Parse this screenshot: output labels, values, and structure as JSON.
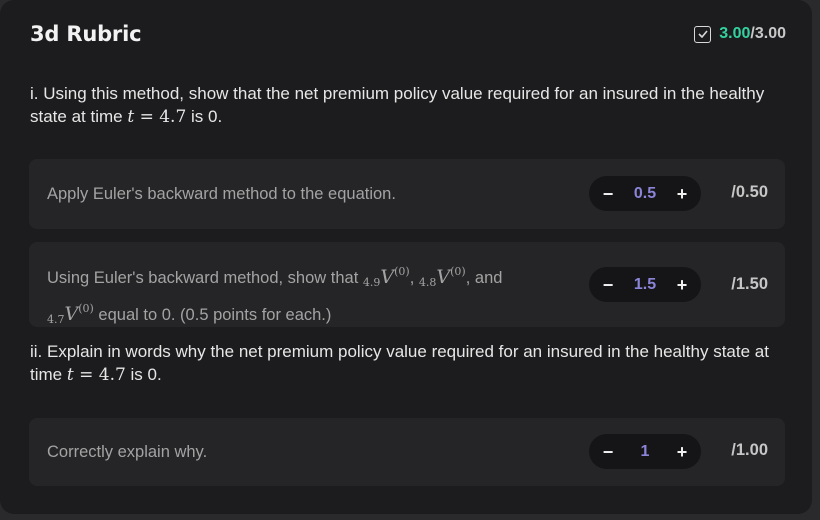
{
  "header": {
    "title": "3d Rubric",
    "score_got": "3.00",
    "score_total": "/3.00",
    "icon": "checkbox-check-icon"
  },
  "section_i": {
    "text_before": "i. Using this method, show that the net premium policy value required for an insured in the healthy state at time ",
    "math_var": "t",
    "math_eq": " = ",
    "math_num": "4.7",
    "text_after": " is 0."
  },
  "items_i": [
    {
      "text": "Apply Euler's backward method to the equation.",
      "value": "0.5",
      "max": "/0.50"
    },
    {
      "text_before": "Using Euler's backward method, show that ",
      "sub1": "4.9",
      "sub2": "4.8",
      "sub3": "4.7",
      "var": "V",
      "sup": "(0)",
      "sep1": ", ",
      "sep2": ", and",
      "text_after": " equal to 0. (0.5 points for each.)",
      "value": "1.5",
      "max": "/1.50"
    }
  ],
  "section_ii": {
    "text_before": "ii. Explain in words why the net premium policy value required for an insured in the healthy state at time ",
    "math_var": "t",
    "math_eq": " = ",
    "math_num": "4.7",
    "text_after": " is 0."
  },
  "items_ii": [
    {
      "text": "Correctly explain why.",
      "value": "1",
      "max": "/1.00"
    }
  ],
  "stepper": {
    "minus": "−",
    "plus": "+"
  },
  "colors": {
    "score_accent": "#33d1a0",
    "value_accent": "#8b84d8",
    "card_bg": "#1c1c1e",
    "item_bg": "#252527"
  }
}
